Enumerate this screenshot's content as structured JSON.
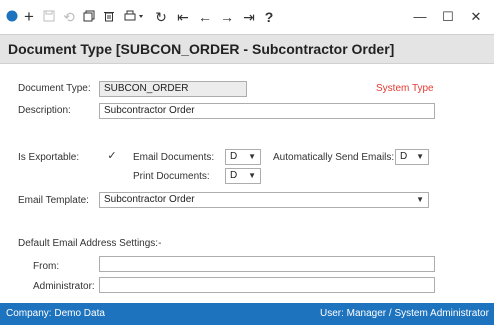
{
  "toolbar": {
    "icons": [
      "circle-icon",
      "add-icon",
      "save-icon",
      "undo-icon",
      "copy-icon",
      "delete-icon",
      "print-icon",
      "refresh-icon",
      "first-record-icon",
      "previous-record-icon",
      "next-record-icon",
      "last-record-icon",
      "help-icon"
    ],
    "help_label": "?",
    "accent": "#1e73be"
  },
  "window": {
    "minimize": "—",
    "maximize": "☐",
    "close": "✕"
  },
  "header": {
    "title": "Document Type [SUBCON_ORDER - Subcontractor Order]"
  },
  "form": {
    "document_type": {
      "label": "Document Type:",
      "value": "SUBCON_ORDER"
    },
    "system_type": "System Type",
    "description": {
      "label": "Description:",
      "value": "Subcontractor Order"
    },
    "is_exportable": {
      "label": "Is Exportable:",
      "checked": "✓"
    },
    "email_documents": {
      "label": "Email Documents:",
      "value": "D"
    },
    "auto_send_emails": {
      "label": "Automatically Send Emails:",
      "value": "D"
    },
    "print_documents": {
      "label": "Print Documents:",
      "value": "D"
    },
    "email_template": {
      "label": "Email Template:",
      "value": "Subcontractor Order"
    },
    "default_email_heading": "Default Email Address Settings:-",
    "from": {
      "label": "From:",
      "value": ""
    },
    "administrator": {
      "label": "Administrator:",
      "value": ""
    }
  },
  "status": {
    "company": "Company:  Demo Data",
    "user": "User:  Manager  /  System Administrator"
  }
}
